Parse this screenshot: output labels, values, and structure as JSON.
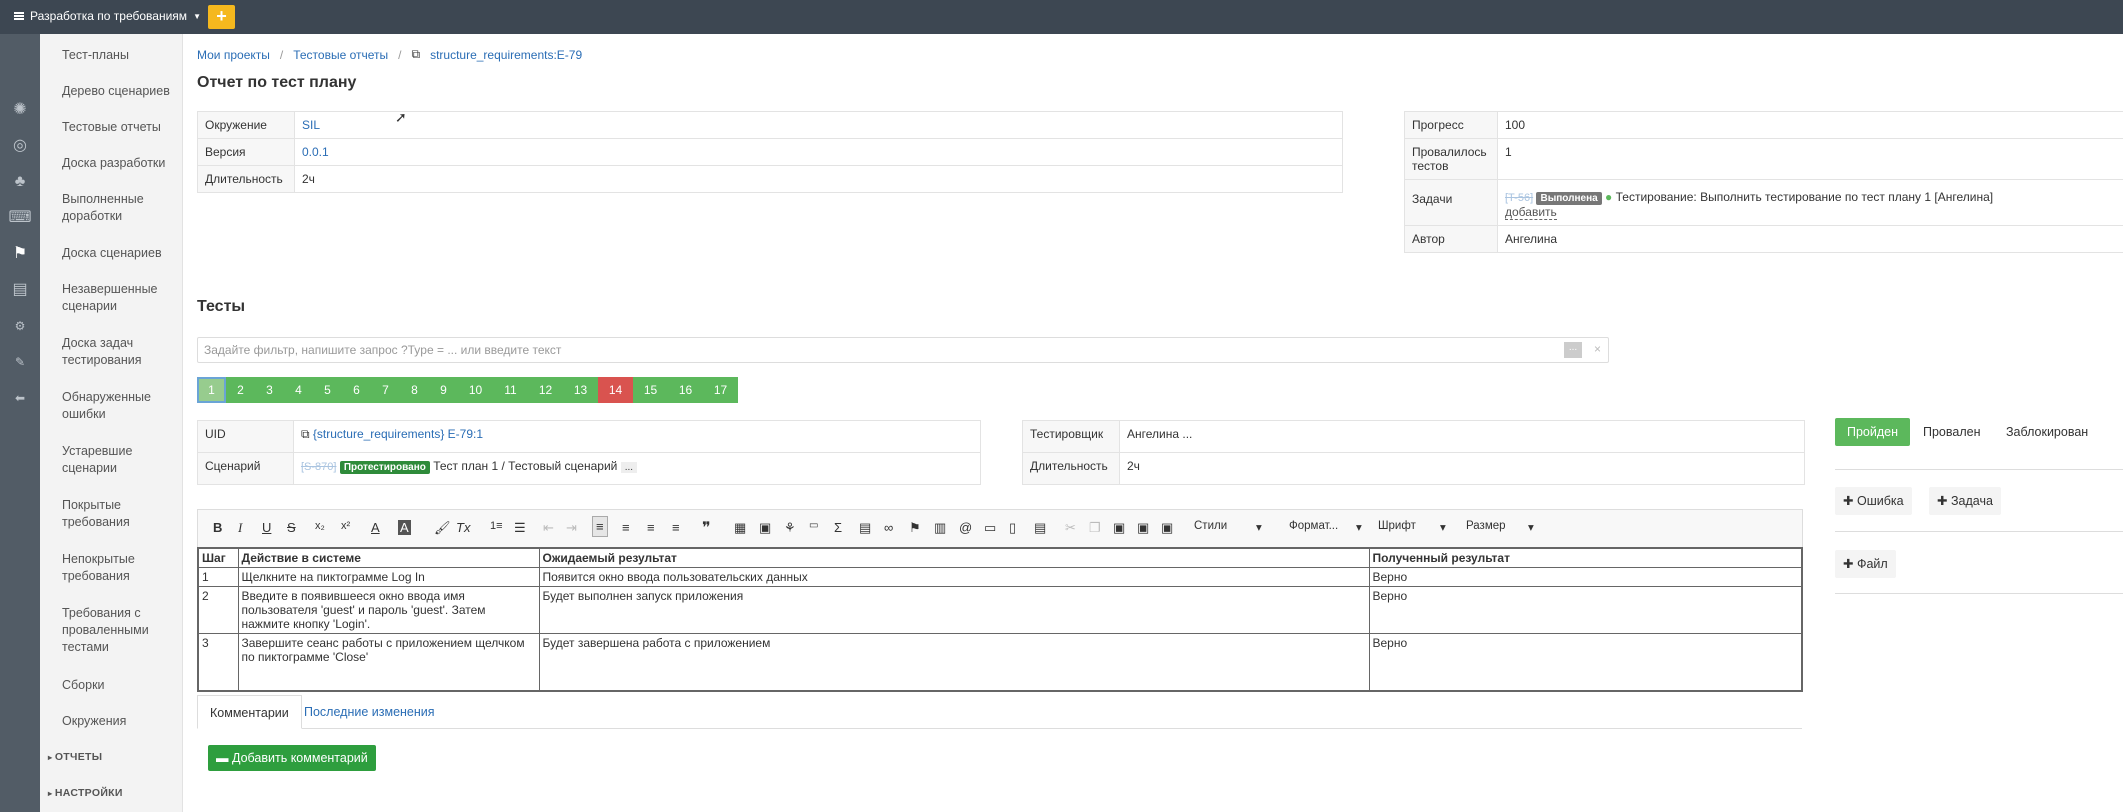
{
  "topbar": {
    "project_menu": "Разработка по требованиям",
    "add_label": "+"
  },
  "nav": {
    "items": [
      "Тест-планы",
      "Дерево сценариев",
      "Тестовые отчеты",
      "Доска разработки",
      "Выполненные доработки",
      "Доска сценариев",
      "Незавершенные сценарии",
      "Доска задач тестирования",
      "Обнаруженные ошибки",
      "Устаревшие сценарии",
      "Покрытые требования",
      "Непокрытые требования",
      "Требования с проваленными тестами",
      "Сборки",
      "Окружения"
    ],
    "sections": [
      "ОТЧЕТЫ",
      "НАСТРОЙКИ"
    ]
  },
  "breadcrumb": {
    "item1": "Мои проекты",
    "item2": "Тестовые отчеты",
    "item3": "structure_requirements:E-79"
  },
  "page_title": "Отчет по тест плану",
  "info_left": {
    "env_label": "Окружение",
    "env_value": "SIL",
    "version_label": "Версия",
    "version_value": "0.0.1",
    "duration_label": "Длительность",
    "duration_value": "2ч"
  },
  "info_right": {
    "progress_label": "Прогресс",
    "progress_value": "100",
    "failed_label": "Провалилось тестов",
    "failed_value": "1",
    "tasks_label": "Задачи",
    "task_id": "[T-56]",
    "task_status": "Выполнена",
    "task_text": "Тестирование: Выполнить тестирование по тест плану 1 [Ангелина]",
    "add_link": "добавить",
    "author_label": "Автор",
    "author_value": "Ангелина"
  },
  "tests": {
    "title": "Тесты",
    "filter_placeholder": "Задайте фильтр, напишите запрос ?Type = ... или введите текст",
    "filter_dots": "...",
    "filter_clear": "×",
    "pages": [
      "1",
      "2",
      "3",
      "4",
      "5",
      "6",
      "7",
      "8",
      "9",
      "10",
      "11",
      "12",
      "13",
      "14",
      "15",
      "16",
      "17"
    ],
    "active_page": "1",
    "failed_page": "14"
  },
  "test_detail": {
    "uid_label": "UID",
    "uid_value": "{structure_requirements} E-79:1",
    "scenario_label": "Сценарий",
    "scenario_id": "[S-870]",
    "scenario_status": "Протестировано",
    "scenario_text": "Тест план 1 / Тестовый сценарий",
    "scenario_more": "...",
    "tester_label": "Тестировщик",
    "tester_value": "Ангелина",
    "tester_more": "...",
    "duration_label": "Длительность",
    "duration_value": "2ч"
  },
  "status_buttons": {
    "passed": "Пройден",
    "failed": "Провален",
    "blocked": "Заблокирован"
  },
  "side_actions": {
    "bug": "Ошибка",
    "task": "Задача",
    "file": "Файл"
  },
  "editor": {
    "styles": "Стили",
    "format": "Формат...",
    "font": "Шрифт",
    "size": "Размер",
    "btn_bold": "B",
    "btn_italic": "I",
    "btn_underline": "U",
    "btn_strike": "S",
    "btn_quote": "❞"
  },
  "steps": {
    "headers": [
      "Шаг",
      "Действие в системе",
      "Ожидаемый результат",
      "Полученный результат"
    ],
    "rows": [
      [
        "1",
        "Щелкните на пиктограмме Log In",
        "Появится окно ввода пользовательских данных",
        "Верно"
      ],
      [
        "2",
        "Введите в появившееся окно ввода имя пользователя 'guest' и пароль 'guest'. Затем нажмите кнопку 'Login'.",
        "Будет выполнен запуск приложения",
        "Верно"
      ],
      [
        "3",
        "Завершите сеанс работы с приложением щелчком по пиктограмме 'Close'",
        "Будет завершена работа с приложением",
        "Верно"
      ]
    ]
  },
  "tabs": {
    "comments": "Комментарии",
    "changes": "Последние изменения"
  },
  "add_comment": "Добавить комментарий",
  "colors": {
    "topbar": "#3d4752",
    "rail": "#525c66",
    "success": "#5cb85c",
    "danger": "#d9534f",
    "accent": "#f5b81e",
    "link": "#2a6db5"
  }
}
